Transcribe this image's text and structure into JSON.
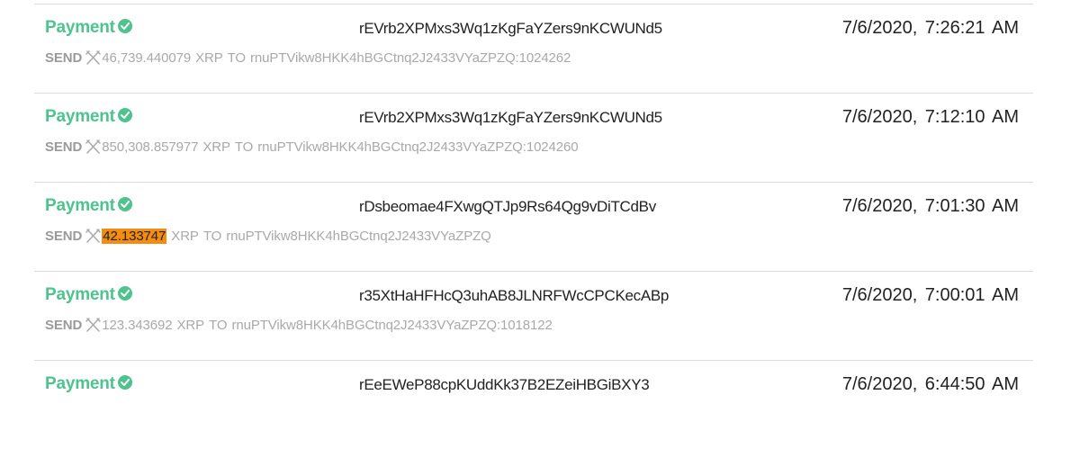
{
  "transactions": [
    {
      "type": "Payment",
      "account": "rEVrb2XPMxs3Wq1zKgFaYZers9nKCWUNd5",
      "datetime": "7/6/2020, 7:26:21 AM",
      "verb": "SEND",
      "amount": "46,739.440079",
      "currency": "XRP",
      "to_word": "TO",
      "destination": "rnuPTVikw8HKK4hBGCtnq2J2433VYaZPZQ:1024262",
      "highlighted": false
    },
    {
      "type": "Payment",
      "account": "rEVrb2XPMxs3Wq1zKgFaYZers9nKCWUNd5",
      "datetime": "7/6/2020, 7:12:10 AM",
      "verb": "SEND",
      "amount": "850,308.857977",
      "currency": "XRP",
      "to_word": "TO",
      "destination": "rnuPTVikw8HKK4hBGCtnq2J2433VYaZPZQ:1024260",
      "highlighted": false
    },
    {
      "type": "Payment",
      "account": "rDsbeomae4FXwgQTJp9Rs64Qg9vDiTCdBv",
      "datetime": "7/6/2020, 7:01:30 AM",
      "verb": "SEND",
      "amount": "42.133747",
      "currency": "XRP",
      "to_word": "TO",
      "destination": "rnuPTVikw8HKK4hBGCtnq2J2433VYaZPZQ",
      "highlighted": true
    },
    {
      "type": "Payment",
      "account": "r35XtHaHFHcQ3uhAB8JLNRFWcCPCKecABp",
      "datetime": "7/6/2020, 7:00:01 AM",
      "verb": "SEND",
      "amount": "123.343692",
      "currency": "XRP",
      "to_word": "TO",
      "destination": "rnuPTVikw8HKK4hBGCtnq2J2433VYaZPZQ:1018122",
      "highlighted": false
    },
    {
      "type": "Payment",
      "account": "rEeEWeP88cpKUddKk37B2EZeiHBGiBXY3",
      "datetime": "7/6/2020, 6:44:50 AM",
      "verb": "",
      "amount": "",
      "currency": "",
      "to_word": "",
      "destination": "",
      "highlighted": false
    }
  ],
  "colors": {
    "type_green": "#4ec38e",
    "highlight_orange": "#f28d12",
    "muted_text": "#a9a9a9"
  },
  "icons": {
    "status": "check-circle-icon",
    "send": "crossed-swords-icon"
  }
}
